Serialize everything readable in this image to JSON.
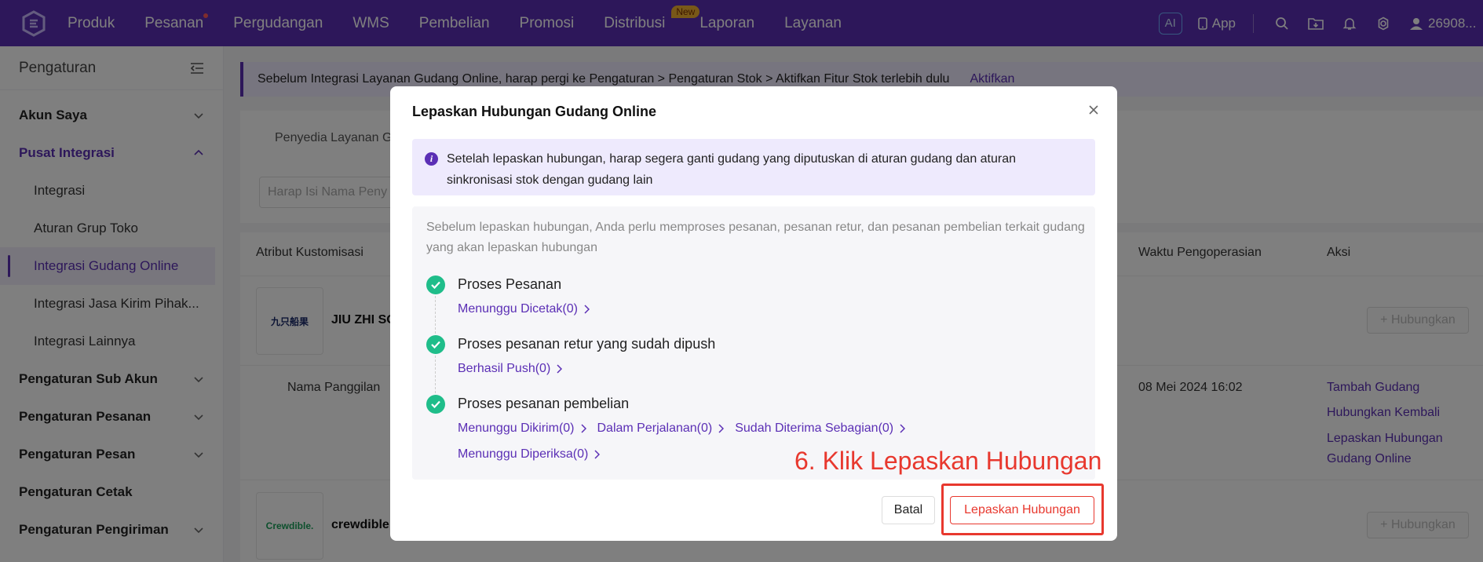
{
  "topbar": {
    "nav": [
      "Produk",
      "Pesanan",
      "Pergudangan",
      "WMS",
      "Pembelian",
      "Promosi",
      "Distribusi",
      "Laporan",
      "Layanan"
    ],
    "distribusi_badge": "New",
    "ai_label": "AI",
    "app_label": "App",
    "user_label": "26908..."
  },
  "sidebar": {
    "title": "Pengaturan",
    "akun_saya": "Akun Saya",
    "pusat_integrasi": "Pusat Integrasi",
    "sub": [
      "Integrasi",
      "Aturan Grup Toko",
      "Integrasi Gudang Online",
      "Integrasi Jasa Kirim Pihak...",
      "Integrasi Lainnya"
    ],
    "groups": [
      "Pengaturan Sub Akun",
      "Pengaturan Pesanan",
      "Pengaturan Pesan",
      "Pengaturan Cetak",
      "Pengaturan Pengiriman"
    ]
  },
  "content": {
    "alert_text": "Sebelum Integrasi Layanan Gudang Online, harap pergi ke Pengaturan > Pengaturan Stok > Aktifkan Fitur Stok terlebih dulu",
    "alert_link": "Aktifkan",
    "tab": "Penyedia Layanan G",
    "search_placeholder": "Harap Isi Nama Peny",
    "col_attr": "Atribut Kustomisasi",
    "col_time": "Waktu Pengoperasian",
    "col_action": "Aksi",
    "row1_logo": "九只船果",
    "row1_name": "JIU ZHI SO",
    "connect_label": "+ Hubungkan",
    "nickname_label": "Nama Panggilan",
    "row_time": "08 Mei 2024 16:02",
    "action_add": "Tambah Gudang",
    "action_reconnect": "Hubungkan Kembali",
    "action_release": "Lepaskan Hubungan Gudang Online",
    "row2_logo": "Crewdible.",
    "row2_name": "crewdible"
  },
  "modal": {
    "title": "Lepaskan Hubungan Gudang Online",
    "info": "Setelah lepaskan hubungan, harap segera ganti gudang yang diputuskan di aturan gudang dan aturan sinkronisasi stok dengan gudang lain",
    "intro": "Sebelum lepaskan hubungan, Anda perlu memproses pesanan, pesanan retur, dan pesanan pembelian terkait gudang yang akan lepaskan hubungan",
    "steps": [
      {
        "title": "Proses Pesanan",
        "links": [
          "Menunggu Dicetak(0)"
        ]
      },
      {
        "title": "Proses pesanan retur yang sudah dipush",
        "links": [
          "Berhasil Push(0)"
        ]
      },
      {
        "title": "Proses pesanan pembelian",
        "links": [
          "Menunggu Dikirim(0)",
          "Dalam Perjalanan(0)",
          "Sudah Diterima Sebagian(0)",
          "Menunggu Diperiksa(0)"
        ]
      }
    ],
    "cancel": "Batal",
    "confirm": "Lepaskan Hubungan"
  },
  "annotation": "6. Klik Lepaskan Hubungan",
  "colors": {
    "brand": "#5b2fb5",
    "danger": "#e8382e",
    "success": "#1fbd8a"
  }
}
